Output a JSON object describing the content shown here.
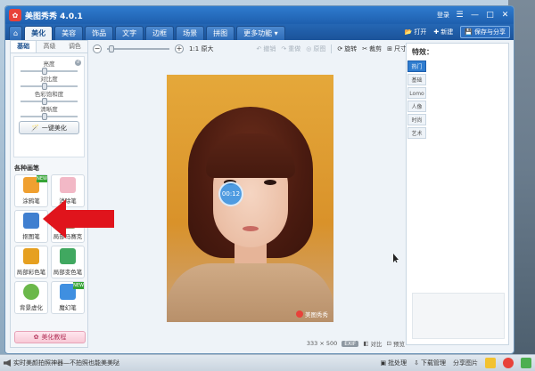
{
  "window": {
    "title": "美图秀秀 4.0.1",
    "login": "登录",
    "controls": [
      "☰",
      "—",
      "□",
      "✕"
    ]
  },
  "tabs": {
    "home": "⌂",
    "items": [
      "美化",
      "美容",
      "饰品",
      "文字",
      "边框",
      "场景",
      "拼图",
      "更多功能"
    ],
    "active": "美化",
    "open": "打开",
    "new": "新建",
    "save_share": "保存与分享"
  },
  "left_panel": {
    "subtabs": [
      "基础",
      "高级",
      "调色"
    ],
    "sliders": [
      {
        "label": "亮度",
        "value": 0.5
      },
      {
        "label": "对比度",
        "value": 0.5
      },
      {
        "label": "色彩饱和度",
        "value": 0.5
      },
      {
        "label": "清晰度",
        "value": 0.5
      }
    ],
    "one_key_button": "一键美化",
    "section_title": "各种画笔",
    "pens": [
      {
        "label": "涂鸦笔",
        "badge": "NEW",
        "color": "#f0a030"
      },
      {
        "label": "消除笔",
        "badge": "",
        "color": "#f2b8c6"
      },
      {
        "label": "抠图笔",
        "badge": "",
        "color": "#3f7fd0"
      },
      {
        "label": "局部马赛克",
        "badge": "",
        "color": "#9a7a5a"
      },
      {
        "label": "局部彩色笔",
        "badge": "",
        "color": "#e6a020"
      },
      {
        "label": "局部变色笔",
        "badge": "",
        "color": "#40a860"
      },
      {
        "label": "背景虚化",
        "badge": "",
        "color": "#6bb84a"
      },
      {
        "label": "魔幻笔",
        "badge": "NEW",
        "color": "#3f8fe0"
      }
    ],
    "tutorial_button": "美化教程"
  },
  "toolbar": {
    "zoom_out": "−",
    "zoom_in": "+",
    "actual_size": "1:1 原大",
    "undo": "撤销",
    "redo": "重做",
    "reset": "原图",
    "rotate": "旋转",
    "crop": "裁剪",
    "resize": "尺寸"
  },
  "canvas": {
    "timer": "00:12",
    "watermark": "美图秀秀",
    "dimensions": "333 × 500",
    "exif": "EXIF",
    "compare": "对比",
    "preview": "预览"
  },
  "right_panel": {
    "title": "特效：",
    "tabs": [
      "热门",
      "基础",
      "Lomo",
      "人像",
      "时尚",
      "艺术"
    ],
    "active": "热门"
  },
  "statusbar": {
    "tip": "实时美颜拍照神器—不拍照也能美美哒",
    "batch": "批处理",
    "download": "下载管理",
    "share": "分享图片"
  },
  "colors": {
    "title_bar": "#2f7ccf",
    "accent_red": "#e8423a"
  }
}
